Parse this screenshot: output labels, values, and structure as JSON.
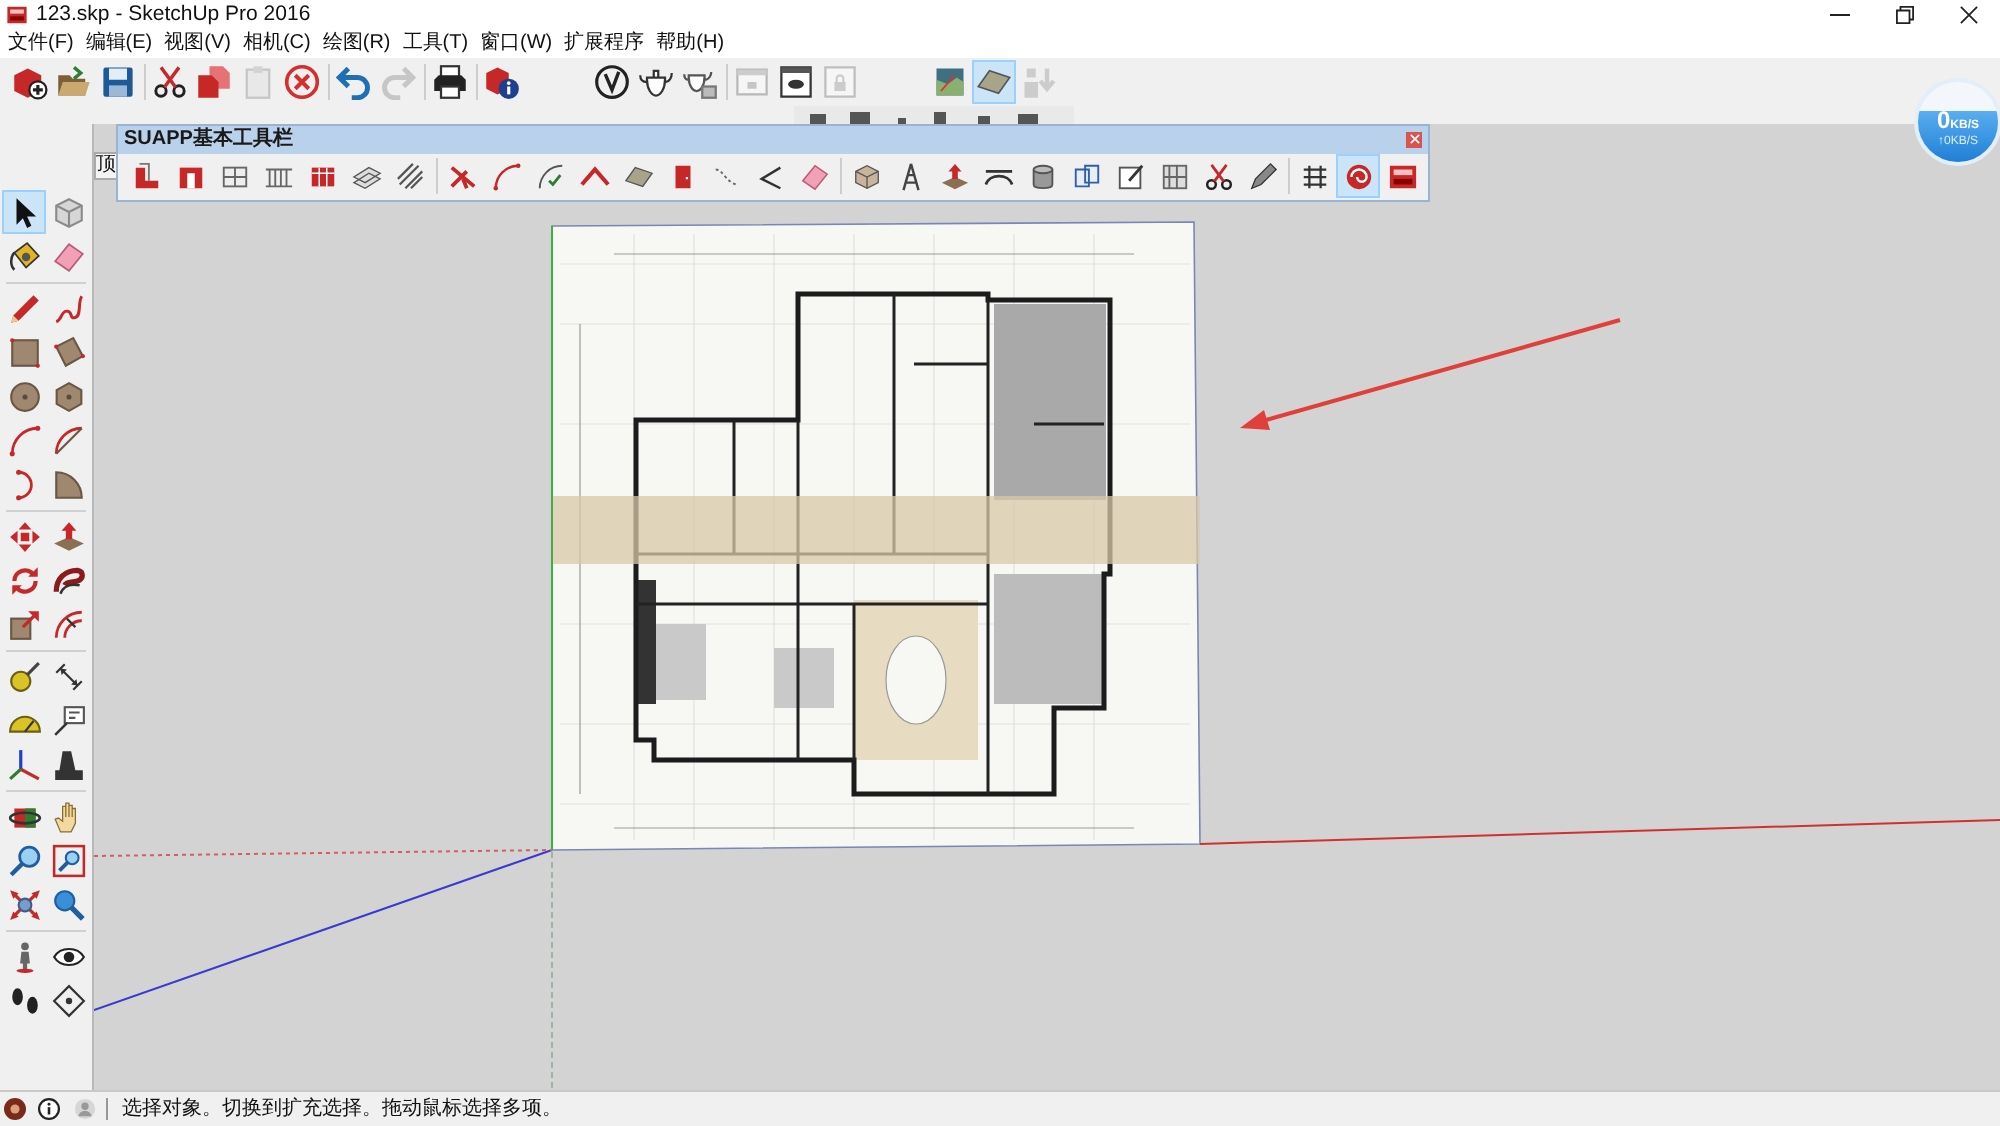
{
  "window": {
    "title": "123.skp - SketchUp Pro 2016"
  },
  "menu": [
    "文件(F)",
    "编辑(E)",
    "视图(V)",
    "相机(C)",
    "绘图(R)",
    "工具(T)",
    "窗口(W)",
    "扩展程序",
    "帮助(H)"
  ],
  "toolbar": {
    "groups": [
      {
        "buttons": [
          {
            "selected": false,
            "disabled": false
          },
          {
            "selected": false,
            "disabled": false
          },
          {
            "selected": false,
            "disabled": false
          }
        ]
      },
      {
        "buttons": [
          {
            "selected": false,
            "disabled": false
          },
          {
            "selected": false,
            "disabled": false
          },
          {
            "selected": false,
            "disabled": true
          },
          {
            "selected": false,
            "disabled": false
          }
        ]
      },
      {
        "buttons": [
          {
            "selected": false,
            "disabled": false
          },
          {
            "selected": false,
            "disabled": true
          }
        ]
      },
      {
        "buttons": [
          {
            "selected": false,
            "disabled": false
          }
        ]
      },
      {
        "buttons": [
          {
            "selected": false,
            "disabled": false
          }
        ]
      },
      {
        "buttons": [
          {
            "selected": false,
            "disabled": false
          },
          {
            "selected": false,
            "disabled": false
          },
          {
            "selected": false,
            "disabled": false
          }
        ]
      },
      {
        "buttons": [
          {
            "selected": false,
            "disabled": true
          },
          {
            "selected": false,
            "disabled": false
          },
          {
            "selected": false,
            "disabled": true
          }
        ]
      },
      {
        "buttons": [
          {
            "selected": false,
            "disabled": false
          },
          {
            "selected": true,
            "disabled": false
          },
          {
            "selected": false,
            "disabled": true
          }
        ]
      }
    ]
  },
  "network_widget": {
    "download": "0",
    "download_unit": "KB/S",
    "upload": "↑0KB/S"
  },
  "scene_tab": {
    "label": "顶"
  },
  "suapp_toolbar": {
    "title": "SUAPP基本工具栏",
    "groups": [
      {
        "buttons": [
          {
            "selected": false
          },
          {
            "selected": false
          },
          {
            "selected": false
          },
          {
            "selected": false
          },
          {
            "selected": false
          },
          {
            "selected": false
          },
          {
            "selected": false
          }
        ]
      },
      {
        "buttons": [
          {
            "selected": false
          },
          {
            "selected": false
          },
          {
            "selected": false
          },
          {
            "selected": false
          },
          {
            "selected": false
          },
          {
            "selected": false
          },
          {
            "selected": false
          },
          {
            "selected": false
          },
          {
            "selected": false
          }
        ]
      },
      {
        "buttons": [
          {
            "selected": false
          },
          {
            "selected": false
          },
          {
            "selected": false
          },
          {
            "selected": false
          },
          {
            "selected": false
          },
          {
            "selected": false
          },
          {
            "selected": false
          },
          {
            "selected": false
          },
          {
            "selected": false
          },
          {
            "selected": false
          }
        ]
      },
      {
        "buttons": [
          {
            "selected": false
          },
          {
            "selected": true
          },
          {
            "selected": false
          }
        ]
      }
    ]
  },
  "left_toolbar": {
    "groups": [
      {
        "buttons": [
          {
            "selected": true
          },
          {
            "selected": false
          },
          {
            "selected": false
          },
          {
            "selected": false
          }
        ]
      },
      {
        "buttons": [
          {
            "selected": false
          },
          {
            "selected": false
          },
          {
            "selected": false
          },
          {
            "selected": false
          },
          {
            "selected": false
          },
          {
            "selected": false
          },
          {
            "selected": false
          },
          {
            "selected": false
          },
          {
            "selected": false
          },
          {
            "selected": false
          }
        ]
      },
      {
        "buttons": [
          {
            "selected": false
          },
          {
            "selected": false
          },
          {
            "selected": false
          },
          {
            "selected": false
          },
          {
            "selected": false
          },
          {
            "selected": false
          }
        ]
      },
      {
        "buttons": [
          {
            "selected": false
          },
          {
            "selected": false
          },
          {
            "selected": false
          },
          {
            "selected": false
          },
          {
            "selected": false
          },
          {
            "selected": false
          }
        ]
      },
      {
        "buttons": [
          {
            "selected": false
          },
          {
            "selected": false
          },
          {
            "selected": false
          },
          {
            "selected": false
          },
          {
            "selected": false
          },
          {
            "selected": false
          }
        ]
      },
      {
        "buttons": [
          {
            "selected": false
          },
          {
            "selected": false
          },
          {
            "selected": false
          },
          {
            "selected": false
          }
        ]
      }
    ]
  },
  "status_bar": {
    "message": "选择对象。切换到扩充选择。拖动鼠标选择多项。"
  }
}
